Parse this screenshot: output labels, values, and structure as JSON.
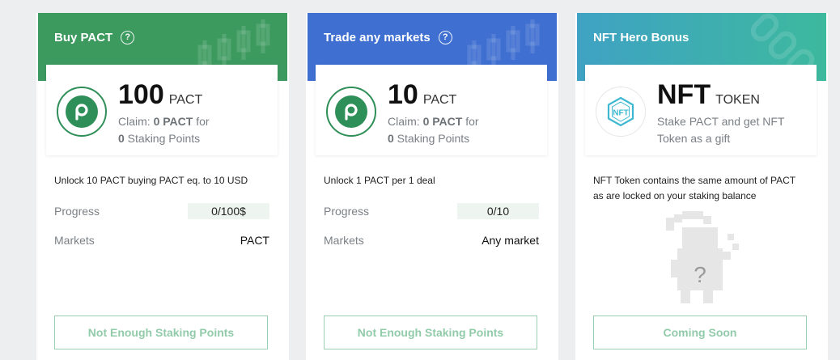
{
  "cards": [
    {
      "title": "Buy PACT",
      "amount": "100",
      "unit": "PACT",
      "claim_prefix": "Claim: ",
      "claim_value": "0 PACT",
      "claim_suffix": " for",
      "points_value": "0",
      "points_label": " Staking Points",
      "description": "Unlock 10 PACT buying PACT eq. to 10 USD",
      "progress_label": "Progress",
      "progress_value": "0/100$",
      "markets_label": "Markets",
      "markets_value": "PACT",
      "button_label": "Not Enough Staking Points"
    },
    {
      "title": "Trade any markets",
      "amount": "10",
      "unit": "PACT",
      "claim_prefix": "Claim: ",
      "claim_value": "0 PACT",
      "claim_suffix": " for",
      "points_value": "0",
      "points_label": " Staking Points",
      "description": "Unlock 1 PACT per 1 deal",
      "progress_label": "Progress",
      "progress_value": "0/10",
      "markets_label": "Markets",
      "markets_value": "Any market",
      "button_label": "Not Enough Staking Points"
    },
    {
      "title": "NFT Hero Bonus",
      "amount": "NFT",
      "unit": "TOKEN",
      "sub_line1": "Stake PACT and get NFT",
      "sub_line2": "Token as a gift",
      "description_line1": "NFT Token contains the same amount of PACT",
      "description_line2": "as are locked on your staking balance",
      "mystery_mark": "?",
      "logo_text": "NFT",
      "button_label": "Coming Soon"
    }
  ],
  "icons": {
    "help": "question-circle-icon",
    "pact_logo": "pact-logo-icon",
    "nft_logo": "nft-logo-icon"
  },
  "help_glyph": "?",
  "colors": {
    "green_banner": "#3d9a5f",
    "blue_banner": "#3e6fd1",
    "teal_banner_start": "#3fa2c4",
    "teal_banner_end": "#3db99e",
    "button_text": "#92cbaa",
    "button_border": "#9ccfb1",
    "progress_bg": "#eef5f0"
  }
}
